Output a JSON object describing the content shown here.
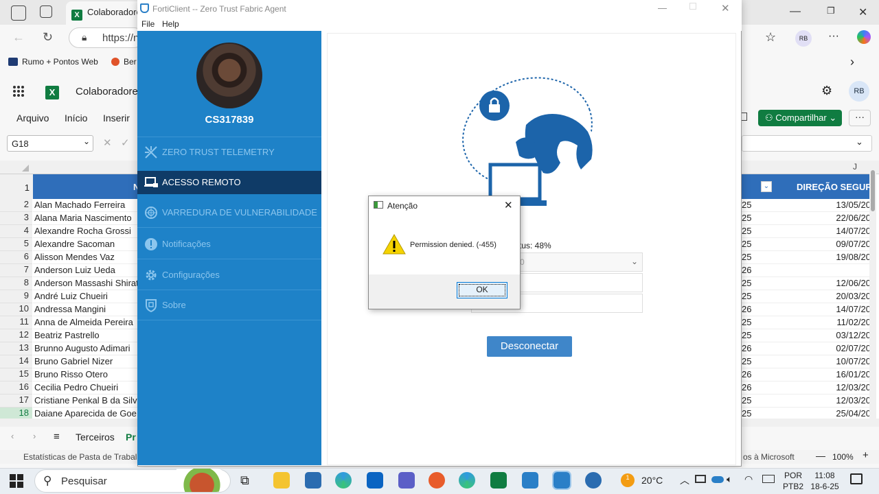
{
  "browser": {
    "tab_title": "Colaboradore",
    "address": "https://n",
    "favorites": [
      "Rumo + Pontos Web",
      "Ber"
    ],
    "profile_initials": "RB"
  },
  "excel": {
    "doc_title": "Colaboradore",
    "ribbon_tabs": [
      "Arquivo",
      "Início",
      "Inserir"
    ],
    "name_box": "G18",
    "share_label": "Compartilhar",
    "profile_initials": "RB",
    "col_j_label": "J",
    "header_truncated": "N",
    "header_right": "DIREÇÃO SEGURA",
    "rows": [
      {
        "num": "1",
        "name": "",
        "y": "",
        "date": ""
      },
      {
        "num": "2",
        "name": "Alan Machado Ferreira",
        "y": "25",
        "date": "13/05/20"
      },
      {
        "num": "3",
        "name": "Alana Maria Nascimento",
        "y": "25",
        "date": "22/06/20"
      },
      {
        "num": "4",
        "name": "Alexandre Rocha Grossi",
        "y": "25",
        "date": "14/07/20"
      },
      {
        "num": "5",
        "name": "Alexandre Sacoman",
        "y": "25",
        "date": "09/07/20"
      },
      {
        "num": "6",
        "name": "Alisson Mendes Vaz",
        "y": "25",
        "date": "19/08/20"
      },
      {
        "num": "7",
        "name": "Anderson Luiz Ueda",
        "y": "26",
        "date": ""
      },
      {
        "num": "8",
        "name": "Anderson Massashi Shirat",
        "y": "25",
        "date": "12/06/20"
      },
      {
        "num": "9",
        "name": "André Luiz Chueiri",
        "y": "25",
        "date": "20/03/20"
      },
      {
        "num": "10",
        "name": "Andressa Mangini",
        "y": "26",
        "date": "14/07/20"
      },
      {
        "num": "11",
        "name": "Anna de Almeida Pereira",
        "y": "25",
        "date": "11/02/20"
      },
      {
        "num": "12",
        "name": "Beatriz Pastrello",
        "y": "25",
        "date": "03/12/20"
      },
      {
        "num": "13",
        "name": "Brunno Augusto Adimari",
        "y": "26",
        "date": "02/07/20"
      },
      {
        "num": "14",
        "name": "Bruno Gabriel Nizer",
        "y": "25",
        "date": "10/07/20"
      },
      {
        "num": "15",
        "name": "Bruno Risso Otero",
        "y": "26",
        "date": "16/01/20"
      },
      {
        "num": "16",
        "name": "Cecilia Pedro Chueiri",
        "y": "26",
        "date": "12/03/20"
      },
      {
        "num": "17",
        "name": "Cristiane Penkal B da Silva",
        "y": "25",
        "date": "12/03/20"
      },
      {
        "num": "18",
        "name": "Daiane Aparecida de Goe",
        "y": "25",
        "date": "25/04/20"
      }
    ],
    "sheet_tabs": [
      "Terceiros",
      "Pr"
    ],
    "status_left": "Estatísticas de Pasta de Trabalho",
    "status_right": "os à Microsoft",
    "zoom": "100%"
  },
  "forticlient": {
    "window_title": "FortiClient -- Zero Trust Fabric Agent",
    "menu": [
      "File",
      "Help"
    ],
    "username": "CS317839",
    "nav": [
      {
        "label": "ZERO TRUST TELEMETRY",
        "icon": "telemetry-icon"
      },
      {
        "label": "ACESSO REMOTO",
        "icon": "laptop-lock-icon"
      },
      {
        "label": "VARREDURA DE VULNERABILIDADE",
        "icon": "radar-icon"
      },
      {
        "label": "Notificações",
        "icon": "alert-icon"
      },
      {
        "label": "Configurações",
        "icon": "gear-icon"
      },
      {
        "label": "Sobre",
        "icon": "shield-icon"
      }
    ],
    "status_text": "tus: 48%",
    "select_value": "0",
    "disconnect_label": "Desconectar"
  },
  "dialog": {
    "title": "Atenção",
    "message": "Permission denied. (-455)",
    "ok_label": "OK"
  },
  "taskbar": {
    "search_placeholder": "Pesquisar",
    "temperature": "20°C",
    "weather_badge": "1",
    "lang_line1": "POR",
    "lang_line2": "PTB2",
    "time": "11:08",
    "date": "18-6-25"
  },
  "colors": {
    "sidebar": "#1e82c8",
    "sidebar_active": "#0f3b67",
    "excel_green": "#107c41",
    "disconnect": "#3f86c9"
  }
}
